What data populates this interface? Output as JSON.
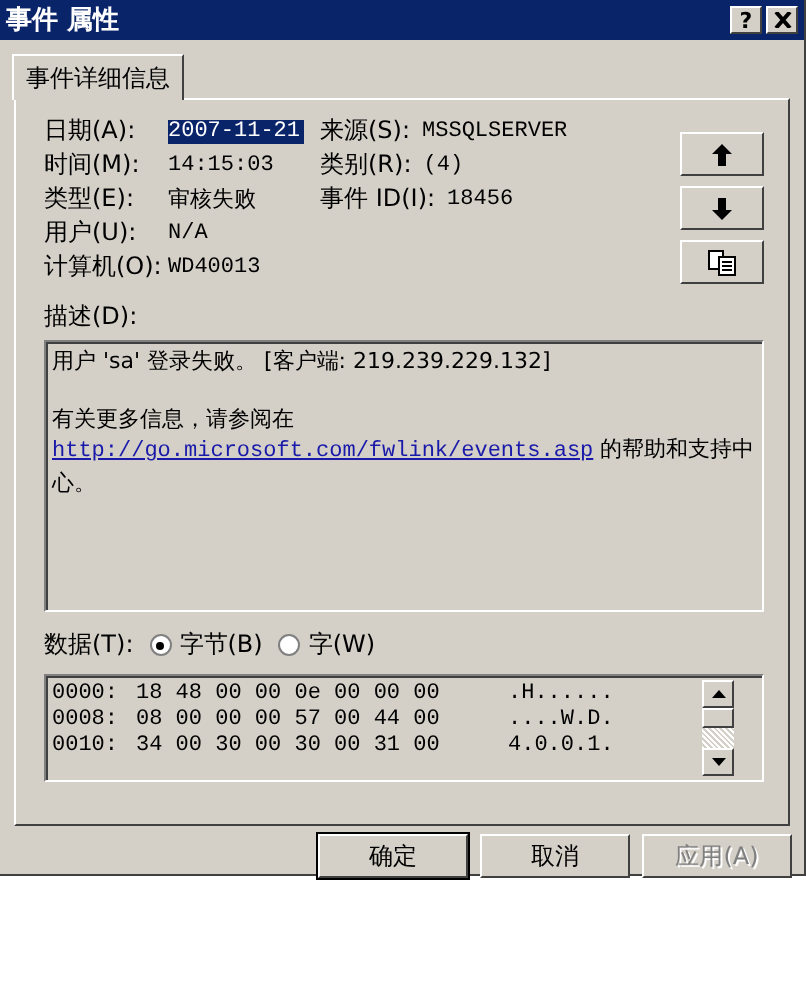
{
  "window": {
    "title": "事件 属性",
    "help": "?"
  },
  "tabs": [
    {
      "label": "事件详细信息",
      "selected": true
    }
  ],
  "fields": [
    {
      "label": "日期(A):",
      "value": "2007-11-21",
      "highlighted": true
    },
    {
      "label": "来源(S):",
      "value": "MSSQLSERVER",
      "highlighted": false
    },
    {
      "label": "时间(M):",
      "value": "14:15:03",
      "highlighted": false
    },
    {
      "label": "类别(R):",
      "value": "(4)",
      "highlighted": false
    },
    {
      "label": "类型(E):",
      "value": "审核失败",
      "highlighted": false
    },
    {
      "label": "事件 ID(I):",
      "value": "18456",
      "highlighted": false
    },
    {
      "label": "用户(U):",
      "value": "N/A",
      "highlighted": false
    },
    {
      "label": "计算机(O):",
      "value": "WD40013",
      "highlighted": false
    }
  ],
  "side_buttons": [
    {
      "kind": "up"
    },
    {
      "kind": "down"
    },
    {
      "kind": "copy"
    }
  ],
  "description": {
    "label": "描述(D):",
    "first_line": "用户 'sa' 登录失败。 [客户端: 219.239.229.132]",
    "more_before": "有关更多信息，请参阅在",
    "link": "http://go.microsoft.com/fwlink/events.asp",
    "more_after": " 的帮助和支持中心。"
  },
  "data": {
    "label": "数据(T):",
    "formats": [
      {
        "label": "字节(B)",
        "selected": true
      },
      {
        "label": "字(W)",
        "selected": false
      }
    ],
    "rows": [
      {
        "offset": "0000:",
        "hex": "18 48 00 00 0e 00 00 00",
        "ascii": ".H......"
      },
      {
        "offset": "0008:",
        "hex": "08 00 00 00 57 00 44 00",
        "ascii": "....W.D."
      },
      {
        "offset": "0010:",
        "hex": "34 00 30 00 30 00 31 00",
        "ascii": "4.0.0.1."
      }
    ]
  },
  "buttons": [
    {
      "label": "确定",
      "default": true,
      "disabled": false
    },
    {
      "label": "取消",
      "default": false,
      "disabled": false
    },
    {
      "label": "应用(A)",
      "default": false,
      "disabled": true
    }
  ]
}
